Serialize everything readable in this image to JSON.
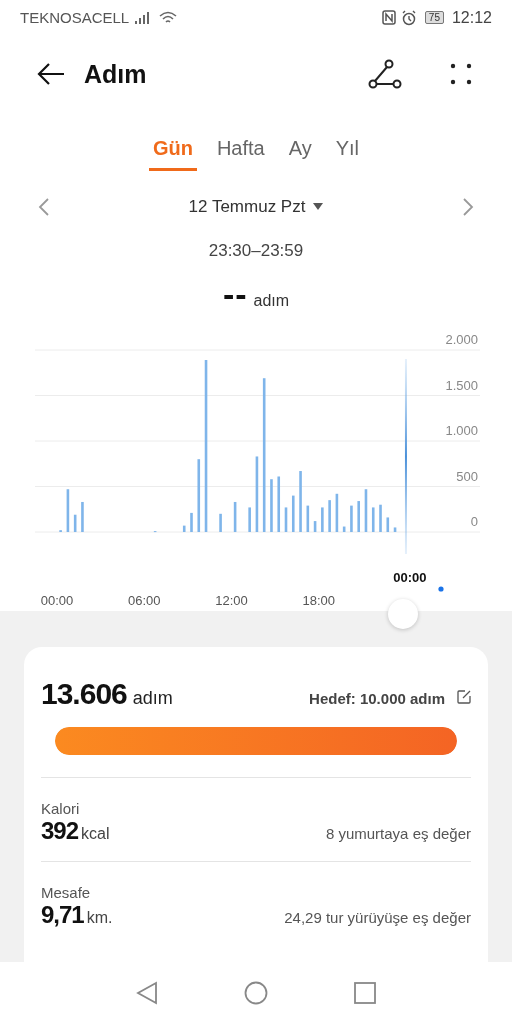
{
  "status_bar": {
    "carrier": "TEKNOSACELL",
    "battery": "75",
    "time": "12:12"
  },
  "header": {
    "title": "Adım"
  },
  "tabs": [
    {
      "label": "Gün",
      "selected": true
    },
    {
      "label": "Hafta",
      "selected": false
    },
    {
      "label": "Ay",
      "selected": false
    },
    {
      "label": "Yıl",
      "selected": false
    }
  ],
  "date_nav": {
    "date": "12 Temmuz Pzt",
    "time_range": "23:30–23:59"
  },
  "current": {
    "value": "--",
    "unit": "adım"
  },
  "chart_data": {
    "type": "bar",
    "xlim": [
      0,
      24
    ],
    "ylim": [
      0,
      2000
    ],
    "grid": true,
    "x": [
      0.25,
      0.75,
      1.25,
      1.75,
      6.75,
      8.75,
      9.25,
      9.75,
      10.25,
      11.25,
      12.25,
      13.25,
      13.75,
      14.25,
      14.75,
      15.25,
      15.75,
      16.25,
      16.75,
      17.25,
      17.75,
      18.25,
      18.75,
      19.25,
      19.75,
      20.25,
      20.75,
      21.25,
      21.75,
      22.25,
      22.75,
      23.25
    ],
    "xticks": [
      {
        "value": 0,
        "label": "00:00"
      },
      {
        "value": 6,
        "label": "06:00"
      },
      {
        "value": 12,
        "label": "12:00"
      },
      {
        "value": 18,
        "label": "18:00"
      }
    ],
    "yticks": [
      {
        "value": 0,
        "label": "0"
      },
      {
        "value": 500,
        "label": "500"
      },
      {
        "value": 1000,
        "label": "1.000"
      },
      {
        "value": 1500,
        "label": "1.500"
      },
      {
        "value": 2000,
        "label": "2.000"
      }
    ],
    "series": [
      {
        "color": "#7fb5ea",
        "values": [
          20,
          470,
          190,
          330,
          10,
          70,
          210,
          800,
          1890,
          200,
          330,
          270,
          830,
          1690,
          580,
          610,
          270,
          400,
          670,
          290,
          120,
          270,
          350,
          420,
          60,
          290,
          340,
          470,
          270,
          300,
          160,
          50
        ]
      }
    ]
  },
  "chart_cursor": {
    "time": "00:00"
  },
  "summary": {
    "steps": "13.606",
    "unit": "adım",
    "goal": "Hedef: 10.000 adım",
    "level": 1
  },
  "metrics": [
    {
      "label": "Kalori",
      "value": "392",
      "unit": "kcal",
      "note": "8 yumurtaya eş değer"
    },
    {
      "label": "Mesafe",
      "value": "9,71",
      "unit": "km.",
      "note": "24,29 tur yürüyüşe eş değer"
    }
  ]
}
